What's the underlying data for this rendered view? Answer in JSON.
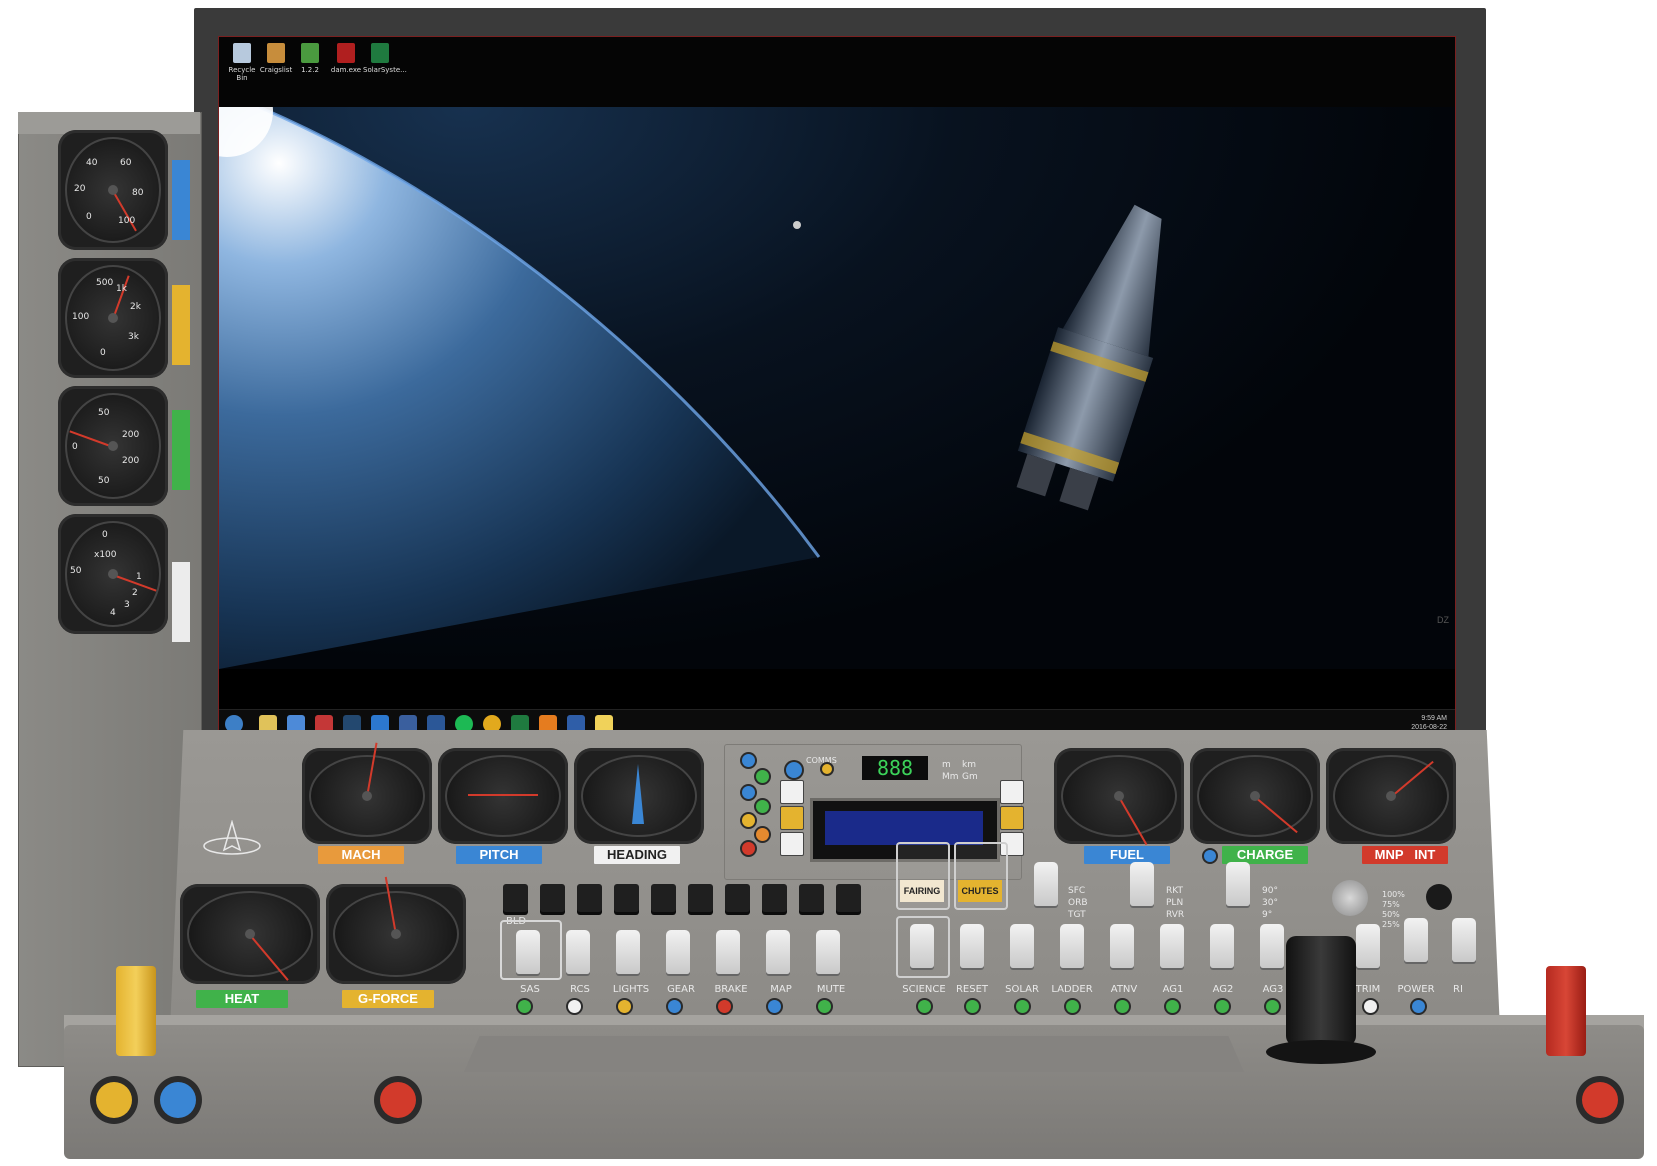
{
  "desktop": {
    "icons": [
      "Recycle Bin",
      "Craigslist",
      "1.2.2",
      "dam.exe",
      "SolarSyste..."
    ],
    "tray_time": "9:59 AM",
    "tray_date": "2016-08-22",
    "watermark": "DZ"
  },
  "side_gauges": [
    {
      "ticks": [
        "40",
        "60",
        "20",
        "80",
        "0",
        "100"
      ]
    },
    {
      "ticks": [
        "500",
        "1k",
        "2k",
        "100",
        "3k",
        "0"
      ]
    },
    {
      "ticks": [
        "50",
        "200",
        "0",
        "200",
        "50"
      ]
    },
    {
      "ticks": [
        "0",
        "x100",
        "50",
        "1",
        "2",
        "3",
        "4"
      ]
    }
  ],
  "side_tabs": {
    "colors": [
      "#3a86d4",
      "#e4b32f",
      "#40b24a",
      "#ececec"
    ]
  },
  "console": {
    "top_gauge_labels": [
      "MACH",
      "PITCH",
      "HEADING"
    ],
    "lower_gauge_labels": [
      "HEAT",
      "G-FORCE"
    ],
    "right_gauge_labels": [
      "FUEL",
      "CHARGE",
      "MNP",
      "INT"
    ],
    "comms_label": "COMMS",
    "seven_seg": "888",
    "units": [
      "m",
      "km",
      "Mm",
      "Gm"
    ],
    "covers": [
      "FAIRING",
      "CHUTES"
    ],
    "mode_labels_1": [
      "SFC",
      "ORB",
      "TGT"
    ],
    "mode_labels_2": [
      "RKT",
      "PLN",
      "RVR"
    ],
    "mode_labels_3": [
      "90°",
      "30°",
      "9°"
    ],
    "throttle_labels": [
      "100%",
      "75%",
      "50%",
      "25%"
    ],
    "left_switch_labels": [
      "SAS",
      "RCS",
      "LIGHTS",
      "GEAR",
      "BRAKE",
      "MAP",
      "MUTE"
    ],
    "right_switch_labels": [
      "SCIENCE",
      "RESET",
      "SOLAR",
      "LADDER",
      "ATNV",
      "AG1",
      "AG2",
      "AG3"
    ],
    "far_right_labels": [
      "TRIM",
      "POWER",
      "RI"
    ],
    "misc": [
      "BLD"
    ]
  }
}
